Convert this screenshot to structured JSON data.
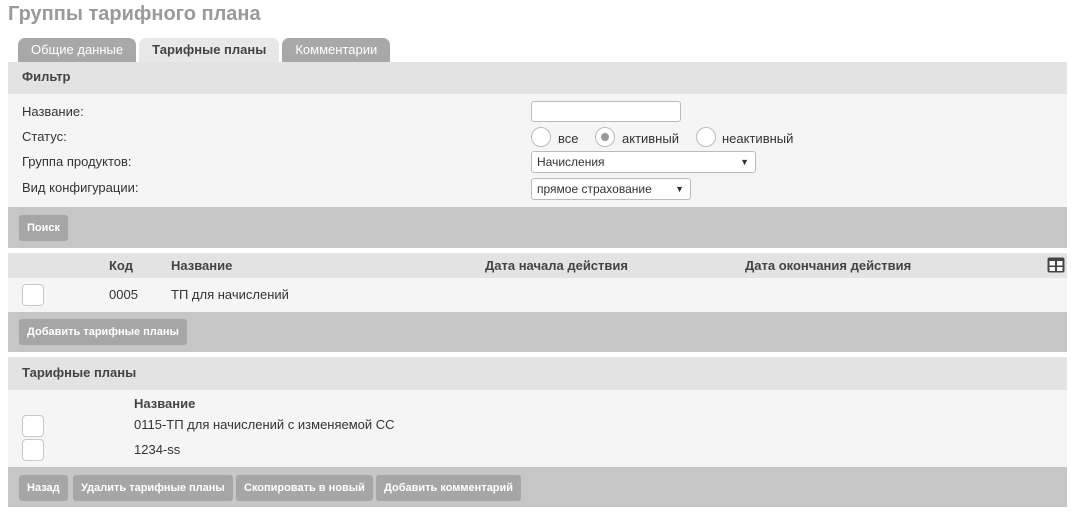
{
  "page": {
    "title": "Группы тарифного плана"
  },
  "tabs": [
    {
      "label": "Общие данные",
      "active": false
    },
    {
      "label": "Тарифные планы",
      "active": true
    },
    {
      "label": "Комментарии",
      "active": false
    }
  ],
  "filter": {
    "header": "Фильтр",
    "labels": {
      "name": "Название:",
      "status": "Статус:",
      "product_group": "Группа продуктов:",
      "config_type": "Вид конфигурации:"
    },
    "name_value": "",
    "status_options": [
      {
        "label": "все",
        "checked": false
      },
      {
        "label": "активный",
        "checked": true
      },
      {
        "label": "неактивный",
        "checked": false
      }
    ],
    "product_group_value": "Начисления",
    "config_type_value": "прямое страхование",
    "search_button": "Поиск"
  },
  "results": {
    "columns": {
      "code": "Код",
      "name": "Название",
      "start_date": "Дата начала действия",
      "end_date": "Дата окончания действия"
    },
    "rows": [
      {
        "code": "0005",
        "name": "ТП для начислений",
        "start_date": "",
        "end_date": ""
      }
    ],
    "add_button": "Добавить тарифные планы",
    "columns_icon": "table-columns-icon"
  },
  "plans": {
    "header": "Тарифные планы",
    "column_name": "Название",
    "rows": [
      {
        "name": "0115-ТП для начислений с изменяемой СС"
      },
      {
        "name": "1234-ss"
      }
    ],
    "buttons": {
      "back": "Назад",
      "delete": "Удалить тарифные планы",
      "copy": "Скопировать в новый",
      "add_comment": "Добавить комментарий"
    }
  },
  "colors": {
    "title": "#9a9a9a",
    "tab_inactive": "#a8a8a8",
    "tab_active": "#e8e8e8",
    "panel_header": "#e3e3e3",
    "panel_body": "#f5f5f5",
    "button_bar": "#c6c6c6",
    "button": "#a6a6a6"
  }
}
